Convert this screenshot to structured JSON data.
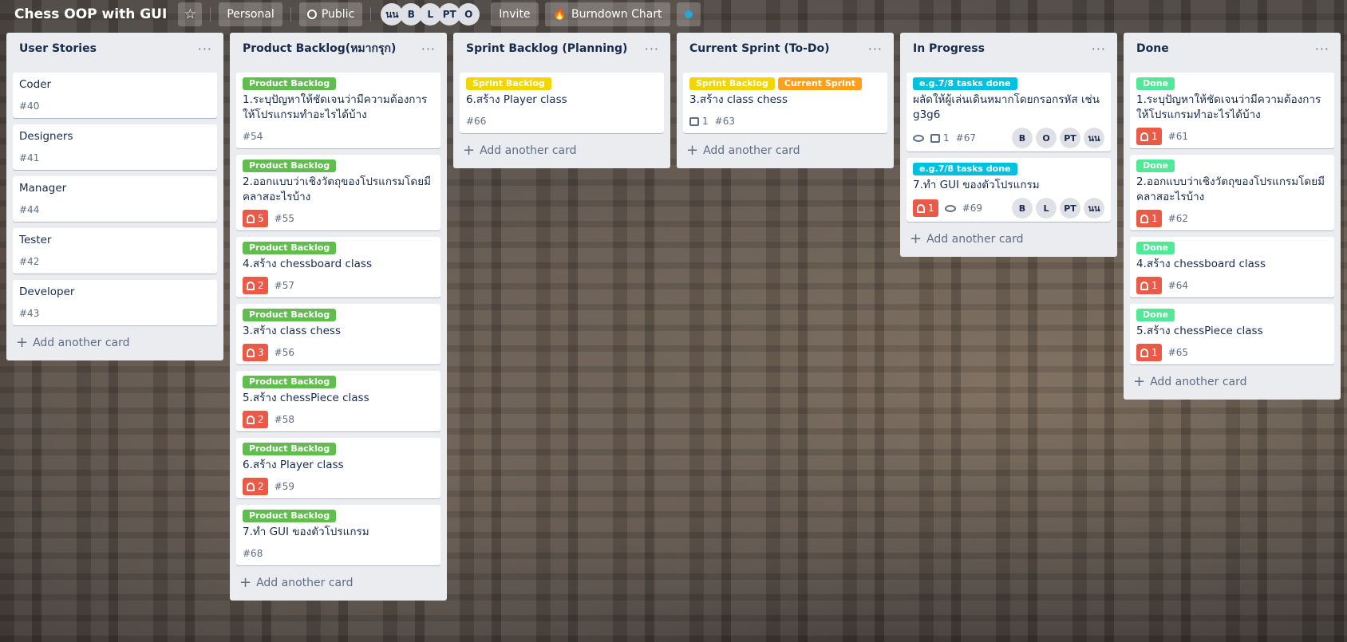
{
  "board": {
    "title": "Chess OOP with GUI",
    "personal": "Personal",
    "visibility": "Public",
    "members": [
      "นน",
      "B",
      "L",
      "PT",
      "O"
    ],
    "invite": "Invite",
    "burndown": "Burndown Chart",
    "colors": {
      "green": "#61bd4f",
      "yellow": "#f2d600",
      "orange": "#ff9f1a",
      "sky": "#00c2e0",
      "lime": "#51e898",
      "due_red": "#eb5a46"
    }
  },
  "add_card_label": "Add another card",
  "lists": [
    {
      "title": "User Stories",
      "cards": [
        {
          "title": "Coder",
          "num": "#40"
        },
        {
          "title": "Designers",
          "num": "#41"
        },
        {
          "title": "Manager",
          "num": "#44"
        },
        {
          "title": "Tester",
          "num": "#42"
        },
        {
          "title": "Developer",
          "num": "#43"
        }
      ]
    },
    {
      "title": "Product Backlog(หมากรุก)",
      "cards": [
        {
          "label": "Product Backlog",
          "title": "1.ระบุปัญหาให้ชัดเจนว่ามีความต้องการให้โปรแกรมทำอะไรได้บ้าง",
          "num": "#54"
        },
        {
          "label": "Product Backlog",
          "title": "2.ออกแบบว่าเชิงวัตถุของโปรแกรมโดยมีคลาสอะไรบ้าง",
          "due": "5",
          "num": "#55"
        },
        {
          "label": "Product Backlog",
          "title": "4.สร้าง chessboard class",
          "due": "2",
          "num": "#57"
        },
        {
          "label": "Product Backlog",
          "title": "3.สร้าง class chess",
          "due": "3",
          "num": "#56"
        },
        {
          "label": "Product Backlog",
          "title": "5.สร้าง chessPiece class",
          "due": "2",
          "num": "#58"
        },
        {
          "label": "Product Backlog",
          "title": "6.สร้าง Player class",
          "due": "2",
          "num": "#59"
        },
        {
          "label": "Product Backlog",
          "title": "7.ทำ GUI ของตัวโปรแกรม",
          "num": "#68"
        }
      ]
    },
    {
      "title": "Sprint Backlog (Planning)",
      "cards": [
        {
          "label": "Sprint Backlog",
          "title": "6.สร้าง Player class",
          "num": "#66"
        }
      ]
    },
    {
      "title": "Current Sprint (To-Do)",
      "cards": [
        {
          "label": "Sprint Backlog",
          "label2": "Current Sprint",
          "title": "3.สร้าง class chess",
          "desc_count": "1",
          "num": "#63"
        }
      ]
    },
    {
      "title": "In Progress",
      "cards": [
        {
          "label": "e.g.7/8 tasks done",
          "title": "ผลัดให้ผู้เล่นเดินหมากโดยกรอกรหัส เช่น g3g6",
          "desc_count": "1",
          "num": "#67",
          "members": [
            "B",
            "O",
            "PT",
            "นน"
          ]
        },
        {
          "label": "e.g.7/8 tasks done",
          "title": "7.ทำ GUI ของตัวโปรแกรม",
          "due": "1",
          "num": "#69",
          "members": [
            "B",
            "L",
            "PT",
            "นน"
          ]
        }
      ]
    },
    {
      "title": "Done",
      "cards": [
        {
          "label": "Done",
          "title": "1.ระบุปัญหาให้ชัดเจนว่ามีความต้องการให้โปรแกรมทำอะไรได้บ้าง",
          "due": "1",
          "num": "#61"
        },
        {
          "label": "Done",
          "title": "2.ออกแบบว่าเชิงวัตถุของโปรแกรมโดยมีคลาสอะไรบ้าง",
          "due": "1",
          "num": "#62"
        },
        {
          "label": "Done",
          "title": "4.สร้าง chessboard class",
          "due": "1",
          "num": "#64"
        },
        {
          "label": "Done",
          "title": "5.สร้าง chessPiece class",
          "due": "1",
          "num": "#65"
        }
      ]
    }
  ]
}
